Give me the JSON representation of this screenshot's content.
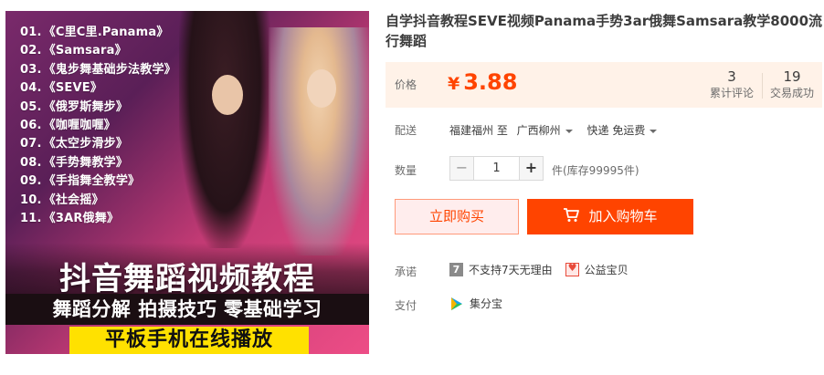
{
  "product_image": {
    "courses": [
      {
        "num": "01.",
        "name": "《C里C里.Panama》"
      },
      {
        "num": "02.",
        "name": "《Samsara》"
      },
      {
        "num": "03.",
        "name": "《鬼步舞基础步法教学》"
      },
      {
        "num": "04.",
        "name": "《SEVE》"
      },
      {
        "num": "05.",
        "name": "《俄罗斯舞步》"
      },
      {
        "num": "06.",
        "name": "《咖喱咖喱》"
      },
      {
        "num": "07.",
        "name": "《太空步滑步》"
      },
      {
        "num": "08.",
        "name": "《手势舞教学》"
      },
      {
        "num": "09.",
        "name": "《手指舞全教学》"
      },
      {
        "num": "10.",
        "name": "《社会摇》"
      },
      {
        "num": "11.",
        "name": "《3AR俄舞》"
      }
    ],
    "title": "抖音舞蹈视频教程",
    "subtitle": "舞蹈分解 拍摄技巧 零基础学习",
    "banner": "平板手机在线播放"
  },
  "product": {
    "title": "自学抖音教程SEVE视频Panama手势3ar俄舞Samsara教学8000流行舞蹈"
  },
  "price": {
    "label": "价格",
    "currency": "¥",
    "amount": "3.88",
    "reviews_count": "3",
    "reviews_label": "累计评论",
    "sales_count": "19",
    "sales_label": "交易成功"
  },
  "delivery": {
    "label": "配送",
    "from": "福建福州 至",
    "to": "广西柳州",
    "shipping": "快递 免运费"
  },
  "quantity": {
    "label": "数量",
    "minus": "−",
    "value": "1",
    "plus": "+",
    "unit_stock": "件(库存99995件)"
  },
  "actions": {
    "buy_now": "立即购买",
    "add_to_cart": "加入购物车"
  },
  "promise": {
    "label": "承诺",
    "icon_text": "7",
    "no_return": "不支持7天无理由",
    "charity": "公益宝贝"
  },
  "payment": {
    "label": "支付",
    "method": "集分宝"
  },
  "colors": {
    "accent": "#ff4400",
    "price_bg": "#fff2e8",
    "banner_yellow": "#ffe100"
  }
}
